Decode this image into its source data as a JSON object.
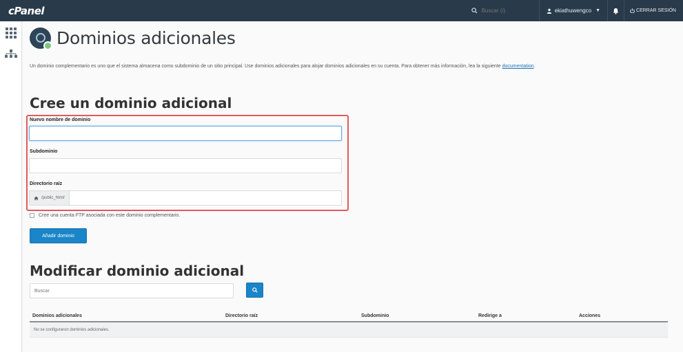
{
  "header": {
    "logo": "cPanel",
    "search_placeholder": "Buscar (/)",
    "username": "ekiathuwengco",
    "logout_label": "CERRAR SESIÓN"
  },
  "page": {
    "title": "Dominios adicionales",
    "intro_text": "Un dominio complementario es uno que el sistema almacena como subdominio de un sitio principal. Use dominios adicionales para alojar dominios adicionales en su cuenta. Para obtener más información, lea la siguiente",
    "intro_link": "documentation",
    "intro_end": "."
  },
  "create": {
    "heading": "Cree un dominio adicional",
    "domain_label": "Nuevo nombre de dominio",
    "domain_value": "",
    "subdomain_label": "Subdominio",
    "subdomain_value": "",
    "docroot_label": "Directorio raíz",
    "docroot_prefix": "/public_html/",
    "docroot_value": "",
    "ftp_label": "Cree una cuenta FTP asociada con este dominio complementario.",
    "add_button": "Añadir dominio"
  },
  "modify": {
    "heading": "Modificar dominio adicional",
    "search_placeholder": "Buscar",
    "search_button_icon": "search-icon",
    "columns": [
      "Dominios adicionales",
      "Directorio raíz",
      "Subdominio",
      "Redirige a",
      "Acciones"
    ],
    "empty_message": "No se configuraron dominios adicionales."
  },
  "colors": {
    "topbar": "#293a4a",
    "primary_button": "#1a85c8",
    "highlight_border": "#e25a5a"
  }
}
